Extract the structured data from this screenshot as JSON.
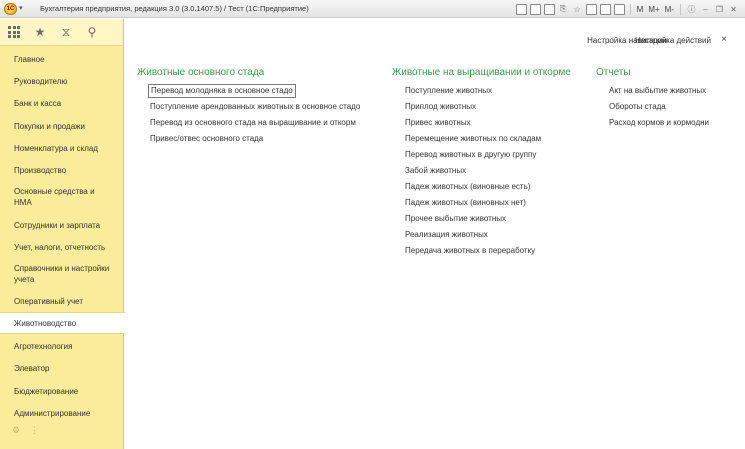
{
  "window": {
    "title": "Бухгалтерия предприятия, редакция 3.0 (3.0.1407.5) / Тест  (1С:Предприятие)",
    "toolbar_texts": [
      "M",
      "M+",
      "M-"
    ]
  },
  "sidebar": {
    "items": [
      {
        "label": "Главное"
      },
      {
        "label": "Руководителю"
      },
      {
        "label": "Банк и касса"
      },
      {
        "label": "Покупки и продажи"
      },
      {
        "label": "Номенклатура и склад"
      },
      {
        "label": "Производство"
      },
      {
        "label": "Основные средства и НМА"
      },
      {
        "label": "Сотрудники и зарплата"
      },
      {
        "label": "Учет, налоги, отчетность"
      },
      {
        "label": "Справочники и настройки учета"
      },
      {
        "label": "Оперативный учет"
      },
      {
        "label": "Животноводство",
        "active": true
      },
      {
        "label": "Агротехнология"
      },
      {
        "label": "Элеватор"
      },
      {
        "label": "Бюджетирование"
      },
      {
        "label": "Администрирование"
      }
    ]
  },
  "header": {
    "nav_settings": "Настройка навигации",
    "action_settings": "Настройка действий",
    "close": "×"
  },
  "sections": {
    "main_herd": {
      "title": "Животные основного стада",
      "items": [
        "Перевод молодняка в основное стадо",
        "Поступление арендованных животных в основное стадо",
        "Перевод из основного стада на выращивание и откорм",
        "Привес/отвес основного стада"
      ]
    },
    "growing": {
      "title": "Животные на выращивании и откорме",
      "items": [
        "Поступление животных",
        "Приплод животных",
        "Привес животных",
        "Перемещение животных по складам",
        "Перевод животных в другую группу",
        "Забой животных",
        "Падеж животных (виновные есть)",
        "Падеж животных (виновных нет)",
        "Прочее выбытие животных",
        "Реализация животных",
        "Передача животных в переработку"
      ]
    },
    "reports": {
      "title": "Отчеты",
      "items": [
        "Акт на выбытие животных",
        "Обороты стада",
        "Расход кормов и кормодни"
      ]
    }
  }
}
